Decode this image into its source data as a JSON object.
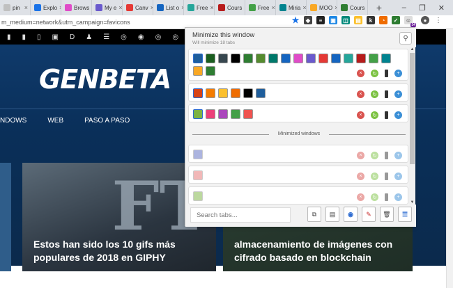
{
  "browser": {
    "tabs": [
      {
        "label": "pin",
        "color": "#c0c0c0"
      },
      {
        "label": "Explo",
        "color": "#1a73e8"
      },
      {
        "label": "Brows",
        "color": "#e04cc8"
      },
      {
        "label": "My e",
        "color": "#6a5acd"
      },
      {
        "label": "Canv",
        "color": "#e53935"
      },
      {
        "label": "List o",
        "color": "#1565c0"
      },
      {
        "label": "Free",
        "color": "#26a69a"
      },
      {
        "label": "Cours",
        "color": "#b71c1c"
      },
      {
        "label": "Free",
        "color": "#43a047"
      },
      {
        "label": "Miria",
        "color": "#00838f"
      },
      {
        "label": "MOO",
        "color": "#f9a825"
      },
      {
        "label": "Cours",
        "color": "#2e7d32"
      }
    ],
    "newtab": "+",
    "window_buttons": [
      "–",
      "❐",
      "✕"
    ],
    "url": "m_medium=network&utm_campaign=favicons",
    "extensions": [
      "star-icon",
      "pocket-icon",
      "layers-icon",
      "ext-blue",
      "ext-teal",
      "ext-yellow",
      "ext-k",
      "ext-pie",
      "ext-todo",
      "tab-manager-icon",
      "avatar"
    ],
    "ext_badge": "34"
  },
  "site": {
    "logo": "GENBETA",
    "nav": [
      "NDOWS",
      "WEB",
      "PASO A PASO"
    ],
    "article1_title": "Estos han sido los 10 gifs más populares de 2018 en GIPHY",
    "article1_art": "FT",
    "article2_title": "almacenamiento de imágenes con cifrado basado en blockchain"
  },
  "popup": {
    "title": "Minimize this window",
    "subtitle": "Will minimize 18 tabs",
    "pin_icon": "pin-icon",
    "windows": [
      {
        "icons": [
          "#1f5e9c",
          "#1b5e20",
          "#37474f",
          "#000000",
          "#2e7d32",
          "#558b2f",
          "#00796b",
          "#1565c0",
          "#e04cc8",
          "#6a5acd",
          "#e53935",
          "#1565c0",
          "#26a69a",
          "#b71c1c",
          "#43a047",
          "#00838f",
          "#f9a825",
          "#2e7d32"
        ]
      },
      {
        "icons": [
          "#d84315",
          "#f57c00",
          "#fbc02d",
          "#ef6c00",
          "#000000",
          "#1f5e9c"
        ]
      },
      {
        "icons": [
          "#7cb342",
          "#ec407a",
          "#ab47bc",
          "#43a047",
          "#ef5350"
        ]
      }
    ],
    "divider_label": "Minimized windows",
    "minimized": [
      {
        "icons": [
          "#5c6bc0"
        ]
      },
      {
        "icons": [
          "#e57373"
        ]
      },
      {
        "icons": [
          "#7cb342"
        ]
      }
    ],
    "search_placeholder": "Search tabs...",
    "footer_buttons": [
      "new-window-icon",
      "folder-icon",
      "eye-icon",
      "pin-icon",
      "trash-icon",
      "menu-icon"
    ]
  }
}
